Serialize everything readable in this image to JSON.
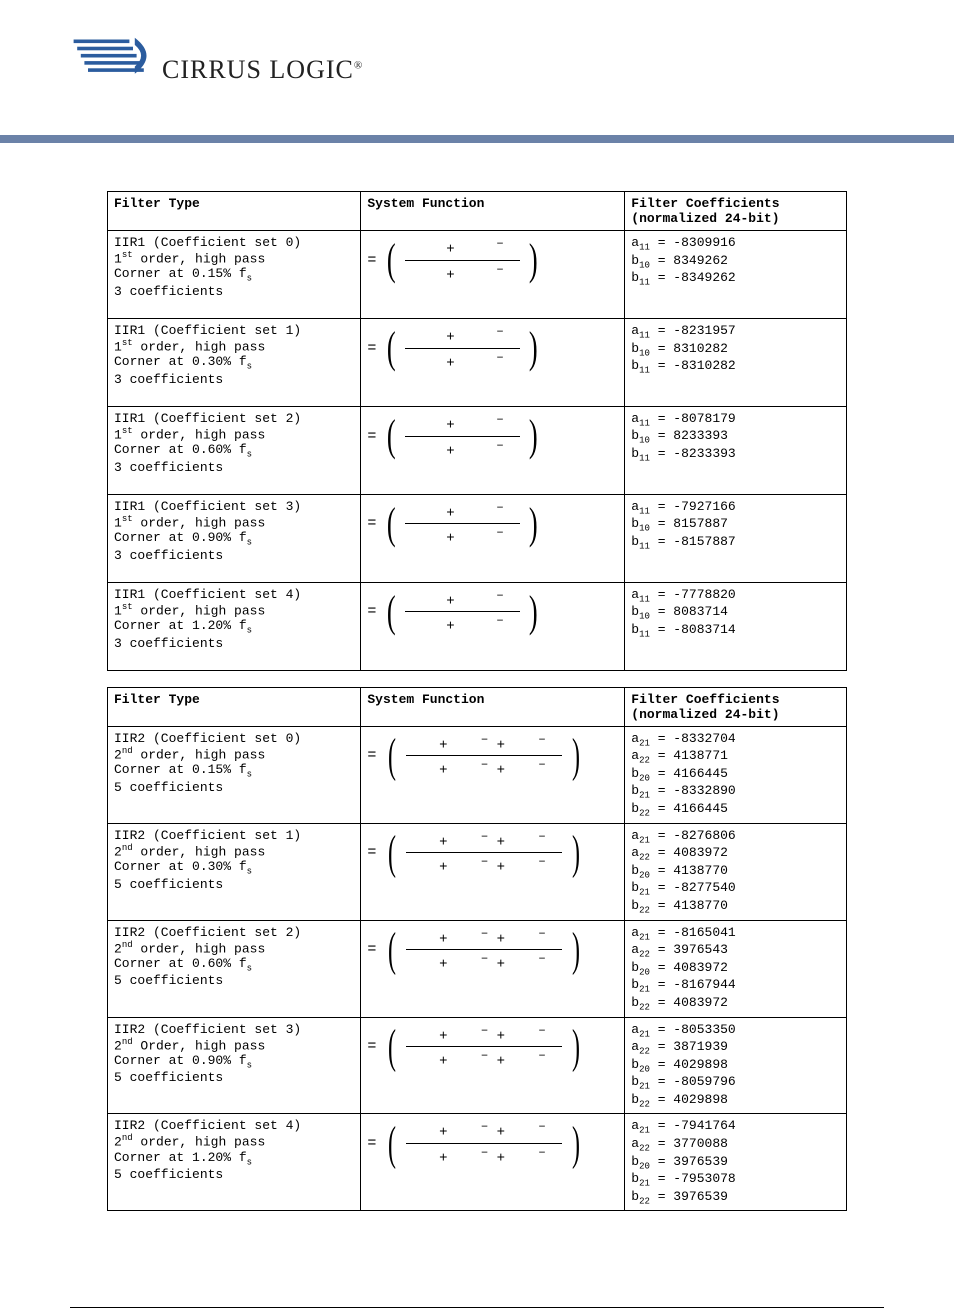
{
  "logo_text": "CIRRUS LOGIC",
  "logo_reg": "®",
  "header1": {
    "c1": "Filter Type",
    "c2": "System Function",
    "c3a": "Filter Coefficients",
    "c3b": "(normalized 24-bit)"
  },
  "iir1": [
    {
      "name": "IIR1 (Coefficient set 0)",
      "order_pre": "1",
      "order_suf": "st",
      "order_post": " order, high pass",
      "corner": "Corner at 0.15% f",
      "corner_sub": "s",
      "ncoef": "3 coefficients",
      "coefs": [
        {
          "lab": "a",
          "s1": "1",
          "s2": "1",
          "v": "-8309916"
        },
        {
          "lab": "b",
          "s1": "1",
          "s2": "0",
          "v": "8349262"
        },
        {
          "lab": "b",
          "s1": "1",
          "s2": "1",
          "v": "-8349262"
        }
      ]
    },
    {
      "name": "IIR1 (Coefficient set 1)",
      "order_pre": "1",
      "order_suf": "st",
      "order_post": " order, high pass",
      "corner": "Corner at 0.30% f",
      "corner_sub": "s",
      "ncoef": "3 coefficients",
      "coefs": [
        {
          "lab": "a",
          "s1": "1",
          "s2": "1",
          "v": "-8231957"
        },
        {
          "lab": "b",
          "s1": "1",
          "s2": "0",
          "v": "8310282"
        },
        {
          "lab": "b",
          "s1": "1",
          "s2": "1",
          "v": "-8310282"
        }
      ]
    },
    {
      "name": "IIR1 (Coefficient set 2)",
      "order_pre": "1",
      "order_suf": "st",
      "order_post": " order, high pass",
      "corner": "Corner at 0.60% f",
      "corner_sub": "s",
      "ncoef": "3 coefficients",
      "coefs": [
        {
          "lab": "a",
          "s1": "1",
          "s2": "1",
          "v": "-8078179"
        },
        {
          "lab": "b",
          "s1": "1",
          "s2": "0",
          "v": "8233393"
        },
        {
          "lab": "b",
          "s1": "1",
          "s2": "1",
          "v": "-8233393"
        }
      ]
    },
    {
      "name": "IIR1 (Coefficient set 3)",
      "order_pre": "1",
      "order_suf": "st",
      "order_post": " order, high pass",
      "corner": "Corner at 0.90% f",
      "corner_sub": "s",
      "ncoef": "3 coefficients",
      "coefs": [
        {
          "lab": "a",
          "s1": "1",
          "s2": "1",
          "v": "-7927166"
        },
        {
          "lab": "b",
          "s1": "1",
          "s2": "0",
          "v": "8157887"
        },
        {
          "lab": "b",
          "s1": "1",
          "s2": "1",
          "v": "-8157887"
        }
      ]
    },
    {
      "name": "IIR1 (Coefficient set 4)",
      "order_pre": "1",
      "order_suf": "st",
      "order_post": " order, high pass",
      "corner": "Corner at 1.20% f",
      "corner_sub": "s",
      "ncoef": "3 coefficients",
      "coefs": [
        {
          "lab": "a",
          "s1": "1",
          "s2": "1",
          "v": "-7778820"
        },
        {
          "lab": "b",
          "s1": "1",
          "s2": "0",
          "v": "8083714"
        },
        {
          "lab": "b",
          "s1": "1",
          "s2": "1",
          "v": "-8083714"
        }
      ]
    }
  ],
  "iir2": [
    {
      "name": "IIR2 (Coefficient set 0)",
      "order_pre": "2",
      "order_suf": "nd",
      "order_post": " order, high pass",
      "corner": "Corner at 0.15% f",
      "corner_sub": "s",
      "ncoef": "5 coefficients",
      "coefs": [
        {
          "lab": "a",
          "s1": "2",
          "s2": "1",
          "v": "-8332704"
        },
        {
          "lab": "a",
          "s1": "2",
          "s2": "2",
          "v": "4138771"
        },
        {
          "lab": "b",
          "s1": "2",
          "s2": "0",
          "v": "4166445"
        },
        {
          "lab": "b",
          "s1": "2",
          "s2": "1",
          "v": "-8332890"
        },
        {
          "lab": "b",
          "s1": "2",
          "s2": "2",
          "v": "4166445"
        }
      ]
    },
    {
      "name": "IIR2 (Coefficient set 1)",
      "order_pre": "2",
      "order_suf": "nd",
      "order_post": " order, high pass",
      "corner": "Corner at 0.30% f",
      "corner_sub": "s",
      "ncoef": "5 coefficients",
      "coefs": [
        {
          "lab": "a",
          "s1": "2",
          "s2": "1",
          "v": "-8276806"
        },
        {
          "lab": "a",
          "s1": "2",
          "s2": "2",
          "v": "4083972"
        },
        {
          "lab": "b",
          "s1": "2",
          "s2": "0",
          "v": "4138770"
        },
        {
          "lab": "b",
          "s1": "2",
          "s2": "1",
          "v": "-8277540"
        },
        {
          "lab": "b",
          "s1": "2",
          "s2": "2",
          "v": "4138770"
        }
      ]
    },
    {
      "name": "IIR2 (Coefficient set 2)",
      "order_pre": "2",
      "order_suf": "nd",
      "order_post": " order, high pass",
      "corner": "Corner at 0.60% f",
      "corner_sub": "s",
      "ncoef": "5 coefficients",
      "coefs": [
        {
          "lab": "a",
          "s1": "2",
          "s2": "1",
          "v": "-8165041"
        },
        {
          "lab": "a",
          "s1": "2",
          "s2": "2",
          "v": "3976543"
        },
        {
          "lab": "b",
          "s1": "2",
          "s2": "0",
          "v": "4083972"
        },
        {
          "lab": "b",
          "s1": "2",
          "s2": "1",
          "v": "-8167944"
        },
        {
          "lab": "b",
          "s1": "2",
          "s2": "2",
          "v": "4083972"
        }
      ]
    },
    {
      "name": "IIR2 (Coefficient set 3)",
      "order_pre": "2",
      "order_suf": "nd",
      "order_post": " Order, high pass",
      "corner": "Corner at 0.90% f",
      "corner_sub": "s",
      "ncoef": "5 coefficients",
      "coefs": [
        {
          "lab": "a",
          "s1": "2",
          "s2": "1",
          "v": "-8053350"
        },
        {
          "lab": "a",
          "s1": "2",
          "s2": "2",
          "v": "3871939"
        },
        {
          "lab": "b",
          "s1": "2",
          "s2": "0",
          "v": "4029898"
        },
        {
          "lab": "b",
          "s1": "2",
          "s2": "1",
          "v": "-8059796"
        },
        {
          "lab": "b",
          "s1": "2",
          "s2": "2",
          "v": "4029898"
        }
      ]
    },
    {
      "name": "IIR2 (Coefficient set 4)",
      "order_pre": "2",
      "order_suf": "nd",
      "order_post": " order, high pass",
      "corner": "Corner at 1.20% f",
      "corner_sub": "s",
      "ncoef": "5 coefficients",
      "coefs": [
        {
          "lab": "a",
          "s1": "2",
          "s2": "1",
          "v": "-7941764"
        },
        {
          "lab": "a",
          "s1": "2",
          "s2": "2",
          "v": "3770088"
        },
        {
          "lab": "b",
          "s1": "2",
          "s2": "0",
          "v": "3976539"
        },
        {
          "lab": "b",
          "s1": "2",
          "s2": "1",
          "v": "-7953078"
        },
        {
          "lab": "b",
          "s1": "2",
          "s2": "2",
          "v": "3976539"
        }
      ]
    }
  ],
  "sym": {
    "eq": "=",
    "plus": "+",
    "minus": "−"
  }
}
